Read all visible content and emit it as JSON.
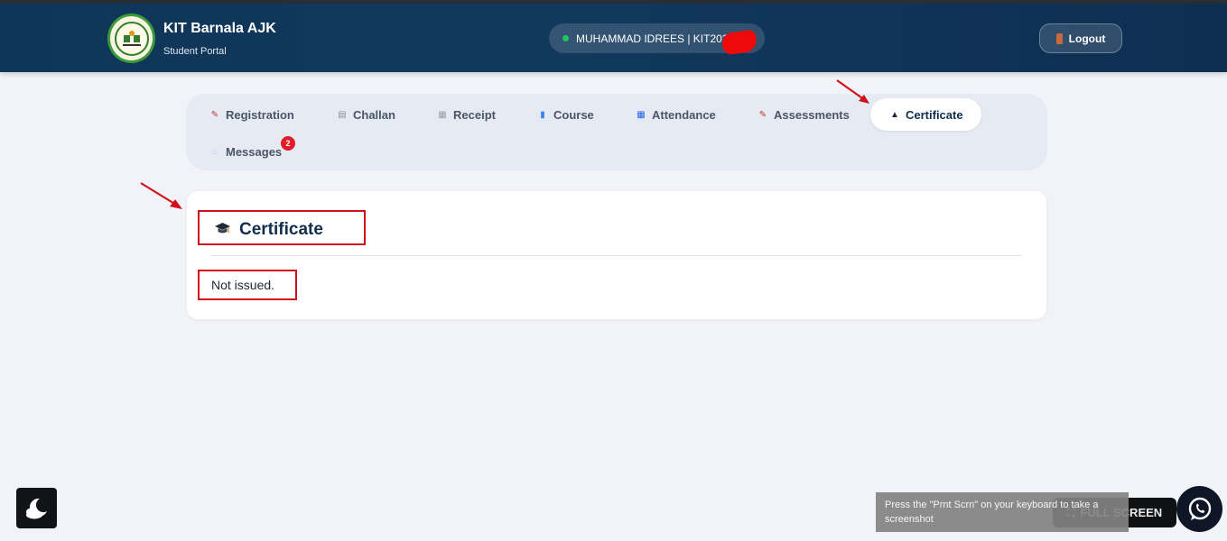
{
  "header": {
    "brand_title": "KIT Barnala AJK",
    "brand_subtitle": "Student Portal",
    "user_label": "MUHAMMAD IDREES | KIT202",
    "logout_label": "Logout",
    "status_color": "#22c55e"
  },
  "tabs": [
    {
      "label": "Registration",
      "icon": "pencil-memo-icon"
    },
    {
      "label": "Challan",
      "icon": "document-icon"
    },
    {
      "label": "Receipt",
      "icon": "receipt-icon"
    },
    {
      "label": "Course",
      "icon": "books-icon"
    },
    {
      "label": "Attendance",
      "icon": "calendar-icon"
    },
    {
      "label": "Assessments",
      "icon": "pencil-memo-icon"
    },
    {
      "label": "Certificate",
      "icon": "graduation-cap-icon",
      "active": true
    },
    {
      "label": "Messages",
      "icon": "speech-bubble-icon",
      "badge": "2"
    }
  ],
  "card": {
    "title": "Certificate",
    "status_text": "Not issued."
  },
  "footer": {
    "full_screen_label": "FULL SCREEN",
    "tooltip": "Press the \"Prnt Scrn\" on your keyboard to take a screenshot"
  },
  "colors": {
    "header_bg": "#12385d",
    "annotation_red": "#d0101b",
    "badge_red": "#e11d2a"
  }
}
